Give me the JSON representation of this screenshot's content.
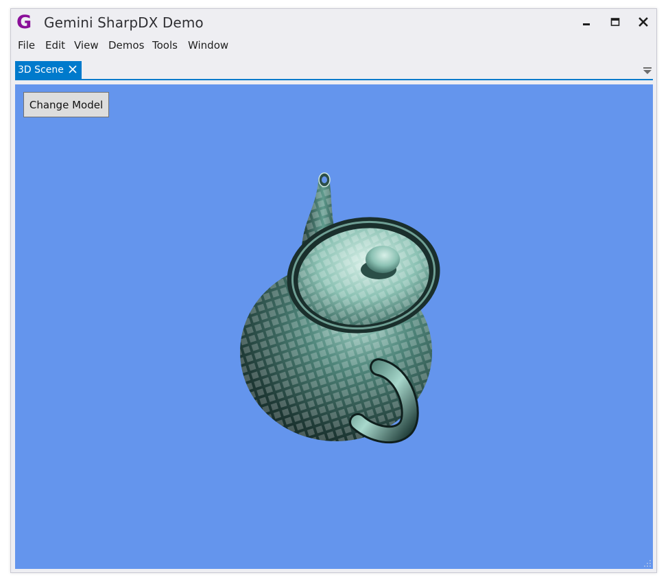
{
  "window": {
    "app_icon_letter": "G",
    "title": "Gemini SharpDX Demo",
    "controls": {
      "minimize": "minimize-icon",
      "maximize": "maximize-icon",
      "close": "close-icon"
    }
  },
  "menu": {
    "items": [
      {
        "label": "File"
      },
      {
        "label": "Edit"
      },
      {
        "label": "View"
      },
      {
        "label": "Demos"
      },
      {
        "label": "Tools"
      },
      {
        "label": "Window"
      }
    ]
  },
  "tabs": {
    "items": [
      {
        "label": "3D Scene",
        "active": true
      }
    ]
  },
  "scene": {
    "change_model_label": "Change Model",
    "model": "teapot",
    "background_color": "#6495ed"
  },
  "colors": {
    "accent": "#007acc",
    "app_icon": "#8a0f99",
    "chrome": "#eeeef2"
  }
}
